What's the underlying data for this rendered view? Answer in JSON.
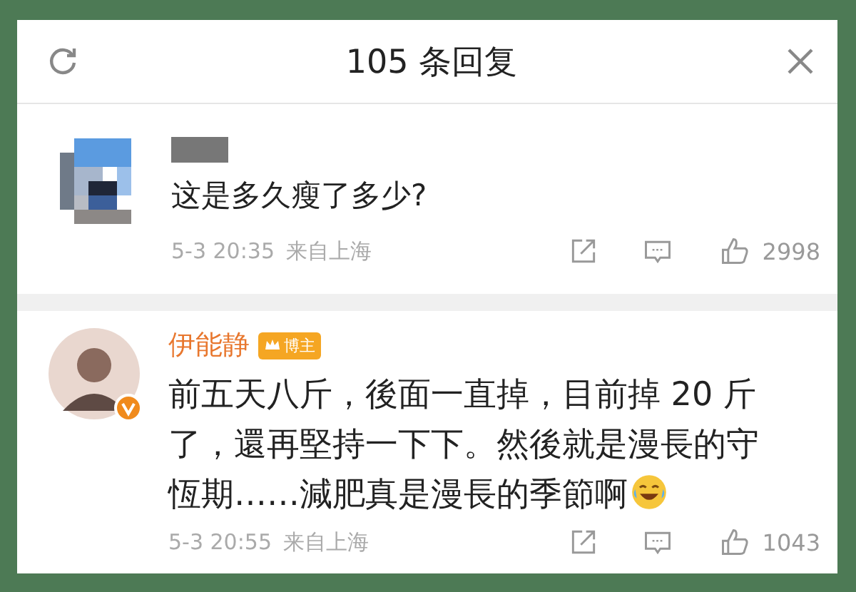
{
  "header": {
    "title": "105 条回复"
  },
  "comments": [
    {
      "kind": "anonymized",
      "text": "这是多久瘦了多少?",
      "time": "5-3 20:35",
      "location": "来自上海",
      "likes": "2998"
    },
    {
      "kind": "blogger",
      "author": "伊能静",
      "badge": "博主",
      "verified": true,
      "text": "前五天八斤，後面一直掉，目前掉 20 斤了，還再堅持一下下。然後就是漫長的守恆期……減肥真是漫長的季節啊",
      "emoji": true,
      "time": "5-3 20:55",
      "location": "来自上海",
      "likes": "1043"
    }
  ]
}
